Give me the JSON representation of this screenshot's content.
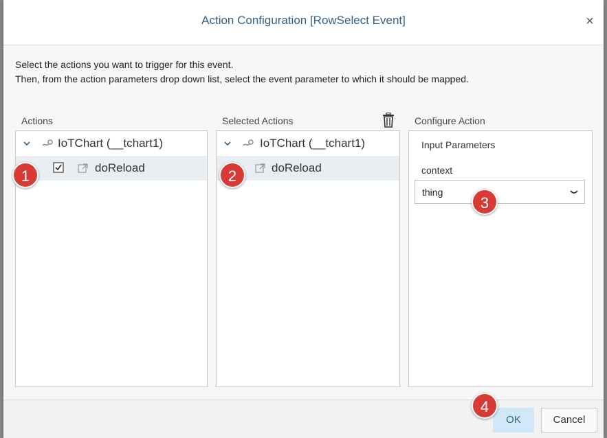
{
  "dialog": {
    "title": "Action Configuration [RowSelect Event]",
    "close_label": "×"
  },
  "description": {
    "line1": "Select the actions you want to trigger for this event.",
    "line2": "Then, from the action parameters drop down list, select the event parameter to which it should be mapped."
  },
  "actions": {
    "label": "Actions",
    "tree": {
      "parent_label": "IoTChart (__tchart1)",
      "child_label": "doReload",
      "child_checked": true
    }
  },
  "selected_actions": {
    "label": "Selected Actions",
    "tree": {
      "parent_label": "IoTChart (__tchart1)",
      "child_label": "doReload"
    }
  },
  "configure": {
    "label": "Configure Action",
    "section_title": "Input Parameters",
    "param_label": "context",
    "param_value": "thing"
  },
  "badges": [
    "1",
    "2",
    "3",
    "4"
  ],
  "footer": {
    "ok_label": "OK",
    "cancel_label": "Cancel"
  },
  "colors": {
    "title": "#346187",
    "badge": "#d83b35",
    "selected_row": "#e9eef2",
    "ok_button": "#d1e8f8"
  },
  "icons": {
    "expand": "chevron-down-icon",
    "node": "chart-node-icon",
    "action": "external-link-icon",
    "delete": "trash-icon",
    "dropdown": "chevron-down-icon"
  }
}
